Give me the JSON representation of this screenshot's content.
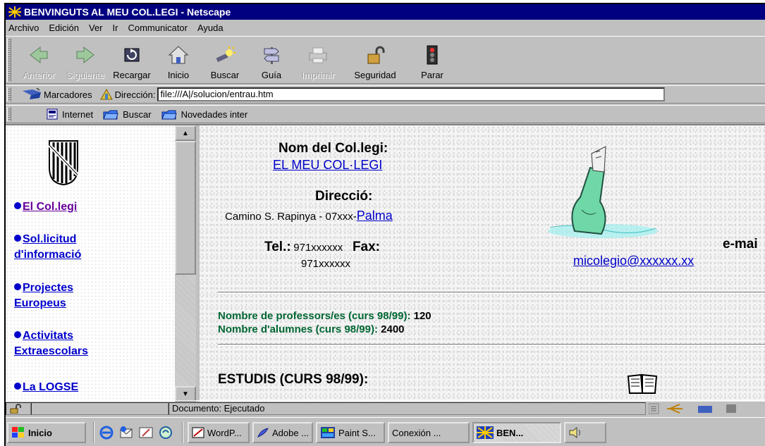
{
  "window": {
    "title": "BENVINGUTS AL MEU COL.LEGI - Netscape"
  },
  "menu": [
    "Archivo",
    "Edición",
    "Ver",
    "Ir",
    "Communicator",
    "Ayuda"
  ],
  "toolbar": {
    "back": "Anterior",
    "forward": "Siguiente",
    "reload": "Recargar",
    "home": "Inicio",
    "search": "Buscar",
    "guide": "Guía",
    "print": "Imprimir",
    "security": "Seguridad",
    "stop": "Parar"
  },
  "location": {
    "bookmarks": "Marcadores",
    "label": "Dirección:",
    "url": "file:///A|/solucion/entrau.htm"
  },
  "personal": [
    "Internet",
    "Buscar",
    "Novedades inter"
  ],
  "nav": {
    "links": [
      {
        "line1": "El Col.legi",
        "line2": ""
      },
      {
        "line1": "Sol.licitud",
        "line2": "d'informació"
      },
      {
        "line1": "Projectes",
        "line2": "Europeus"
      },
      {
        "line1": "Activitats",
        "line2": "Extraescolars"
      },
      {
        "line1": "La LOGSE",
        "line2": ""
      }
    ]
  },
  "main": {
    "name_label": "Nom del Col.legi:",
    "name_value": "EL MEU COL·LEGI",
    "address_label": "Direcció:",
    "address_text": "Camino S. Rapinya - 07xxx-",
    "address_city": "Palma",
    "tel_label": "Tel.:",
    "tel_value": "971xxxxxx",
    "fax_label": "Fax:",
    "fax_value": "971xxxxxx",
    "email_label": "e-mai",
    "email_value": "micolegio@xxxxxx.xx",
    "teachers_label": "Nombre de professors/es (curs 98/99):",
    "teachers_value": "120",
    "students_label": "Nombre d'alumnes (curs 98/99):",
    "students_value": "2400",
    "studies_heading": "ESTUDIS (CURS 98/99):"
  },
  "status": {
    "text": "Documento: Ejecutado"
  },
  "taskbar": {
    "start": "Inicio",
    "tasks": [
      "WordP...",
      "Adobe ...",
      "Paint S...",
      "Conexión ...",
      "BEN..."
    ]
  }
}
